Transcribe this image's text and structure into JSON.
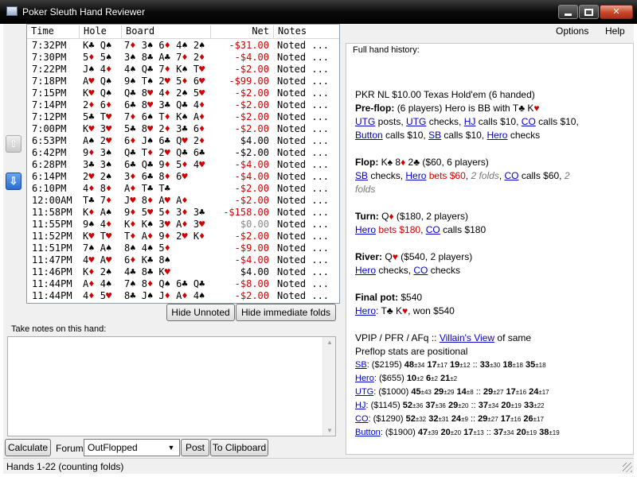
{
  "window": {
    "title": "Poker Sleuth Hand Reviewer",
    "minimize": "",
    "maximize": "",
    "close": "✕"
  },
  "menu": {
    "options": "Options",
    "help": "Help"
  },
  "nav": {
    "up_arrow": "up-arrow-icon",
    "down_arrow": "down-arrow-icon"
  },
  "hands": {
    "columns": [
      "Time",
      "Hole",
      "Board",
      "Net",
      "Notes"
    ],
    "rows": [
      {
        "time": "7:32PM",
        "hole": [
          [
            "K",
            "♣"
          ],
          [
            "Q",
            "♠"
          ]
        ],
        "board": [
          [
            "7",
            "♦"
          ],
          [
            "3",
            "♠"
          ],
          [
            "6",
            "♦"
          ],
          [
            "4",
            "♠"
          ],
          [
            "2",
            "♠"
          ]
        ],
        "net": "-$31.00",
        "net_color": "red",
        "notes": "Noted ..."
      },
      {
        "time": "7:30PM",
        "hole": [
          [
            "5",
            "♦"
          ],
          [
            "5",
            "♠"
          ]
        ],
        "board": [
          [
            "3",
            "♠"
          ],
          [
            "8",
            "♣"
          ],
          [
            "A",
            "♣"
          ],
          [
            "7",
            "♦"
          ],
          [
            "2",
            "♦"
          ]
        ],
        "net": "-$4.00",
        "net_color": "red",
        "notes": "Noted ..."
      },
      {
        "time": "7:22PM",
        "hole": [
          [
            "J",
            "♠"
          ],
          [
            "4",
            "♦"
          ]
        ],
        "board": [
          [
            "4",
            "♠"
          ],
          [
            "Q",
            "♣"
          ],
          [
            "7",
            "♦"
          ],
          [
            "K",
            "♠"
          ],
          [
            "T",
            "♥"
          ]
        ],
        "net": "-$2.00",
        "net_color": "red",
        "notes": "Noted ..."
      },
      {
        "time": "7:18PM",
        "hole": [
          [
            "A",
            "♥"
          ],
          [
            "Q",
            "♠"
          ]
        ],
        "board": [
          [
            "9",
            "♠"
          ],
          [
            "T",
            "♠"
          ],
          [
            "2",
            "♥"
          ],
          [
            "5",
            "♦"
          ],
          [
            "6",
            "♥"
          ]
        ],
        "net": "-$99.00",
        "net_color": "red",
        "notes": "Noted ..."
      },
      {
        "time": "7:15PM",
        "hole": [
          [
            "K",
            "♥"
          ],
          [
            "Q",
            "♠"
          ]
        ],
        "board": [
          [
            "Q",
            "♣"
          ],
          [
            "8",
            "♥"
          ],
          [
            "4",
            "♦"
          ],
          [
            "2",
            "♠"
          ],
          [
            "5",
            "♥"
          ]
        ],
        "net": "-$2.00",
        "net_color": "red",
        "notes": "Noted ..."
      },
      {
        "time": "7:14PM",
        "hole": [
          [
            "2",
            "♦"
          ],
          [
            "6",
            "♦"
          ]
        ],
        "board": [
          [
            "6",
            "♣"
          ],
          [
            "8",
            "♥"
          ],
          [
            "3",
            "♣"
          ],
          [
            "Q",
            "♣"
          ],
          [
            "4",
            "♦"
          ]
        ],
        "net": "-$2.00",
        "net_color": "red",
        "notes": "Noted ..."
      },
      {
        "time": "7:12PM",
        "hole": [
          [
            "5",
            "♣"
          ],
          [
            "T",
            "♥"
          ]
        ],
        "board": [
          [
            "7",
            "♦"
          ],
          [
            "6",
            "♠"
          ],
          [
            "T",
            "♦"
          ],
          [
            "K",
            "♠"
          ],
          [
            "A",
            "♦"
          ]
        ],
        "net": "-$2.00",
        "net_color": "red",
        "notes": "Noted ..."
      },
      {
        "time": "7:00PM",
        "hole": [
          [
            "K",
            "♥"
          ],
          [
            "3",
            "♥"
          ]
        ],
        "board": [
          [
            "5",
            "♣"
          ],
          [
            "8",
            "♥"
          ],
          [
            "2",
            "♦"
          ],
          [
            "3",
            "♣"
          ],
          [
            "6",
            "♦"
          ]
        ],
        "net": "-$2.00",
        "net_color": "red",
        "notes": "Noted ..."
      },
      {
        "time": "6:53PM",
        "hole": [
          [
            "A",
            "♠"
          ],
          [
            "2",
            "♥"
          ]
        ],
        "board": [
          [
            "6",
            "♦"
          ],
          [
            "J",
            "♠"
          ],
          [
            "6",
            "♣"
          ],
          [
            "Q",
            "♥"
          ],
          [
            "2",
            "♦"
          ]
        ],
        "net": "$4.00",
        "net_color": "black",
        "notes": "Noted ..."
      },
      {
        "time": "6:42PM",
        "hole": [
          [
            "9",
            "♦"
          ],
          [
            "3",
            "♠"
          ]
        ],
        "board": [
          [
            "Q",
            "♣"
          ],
          [
            "T",
            "♦"
          ],
          [
            "2",
            "♥"
          ],
          [
            "Q",
            "♣"
          ],
          [
            "6",
            "♣"
          ]
        ],
        "net": "-$2.00",
        "net_color": "black",
        "notes": "Noted ..."
      },
      {
        "time": "6:28PM",
        "hole": [
          [
            "3",
            "♣"
          ],
          [
            "3",
            "♠"
          ]
        ],
        "board": [
          [
            "6",
            "♣"
          ],
          [
            "Q",
            "♣"
          ],
          [
            "9",
            "♦"
          ],
          [
            "5",
            "♦"
          ],
          [
            "4",
            "♥"
          ]
        ],
        "net": "-$4.00",
        "net_color": "red",
        "notes": "Noted ..."
      },
      {
        "time": "6:14PM",
        "hole": [
          [
            "2",
            "♥"
          ],
          [
            "2",
            "♠"
          ]
        ],
        "board": [
          [
            "3",
            "♦"
          ],
          [
            "6",
            "♣"
          ],
          [
            "8",
            "♦"
          ],
          [
            "6",
            "♥"
          ]
        ],
        "net": "-$4.00",
        "net_color": "red",
        "notes": "Noted ..."
      },
      {
        "time": "6:10PM",
        "hole": [
          [
            "4",
            "♦"
          ],
          [
            "8",
            "♦"
          ]
        ],
        "board": [
          [
            "A",
            "♦"
          ],
          [
            "T",
            "♣"
          ],
          [
            "T",
            "♣"
          ]
        ],
        "net": "-$2.00",
        "net_color": "red",
        "notes": "Noted ..."
      },
      {
        "time": "12:00AM",
        "hole": [
          [
            "T",
            "♣"
          ],
          [
            "7",
            "♦"
          ]
        ],
        "board": [
          [
            "J",
            "♥"
          ],
          [
            "8",
            "♦"
          ],
          [
            "A",
            "♥"
          ],
          [
            "A",
            "♦"
          ]
        ],
        "net": "-$2.00",
        "net_color": "red",
        "notes": "Noted ..."
      },
      {
        "time": "11:58PM",
        "hole": [
          [
            "K",
            "♦"
          ],
          [
            "A",
            "♠"
          ]
        ],
        "board": [
          [
            "9",
            "♦"
          ],
          [
            "5",
            "♥"
          ],
          [
            "5",
            "♦"
          ],
          [
            "3",
            "♦"
          ],
          [
            "3",
            "♣"
          ]
        ],
        "net": "-$158.00",
        "net_color": "red",
        "notes": "Noted ..."
      },
      {
        "time": "11:55PM",
        "hole": [
          [
            "9",
            "♠"
          ],
          [
            "4",
            "♦"
          ]
        ],
        "board": [
          [
            "K",
            "♦"
          ],
          [
            "K",
            "♠"
          ],
          [
            "3",
            "♥"
          ],
          [
            "A",
            "♦"
          ],
          [
            "3",
            "♥"
          ]
        ],
        "net": "$0.00",
        "net_color": "grey",
        "notes": "Noted ..."
      },
      {
        "time": "11:52PM",
        "hole": [
          [
            "K",
            "♥"
          ],
          [
            "T",
            "♥"
          ]
        ],
        "board": [
          [
            "T",
            "♦"
          ],
          [
            "A",
            "♦"
          ],
          [
            "9",
            "♦"
          ],
          [
            "2",
            "♥"
          ],
          [
            "K",
            "♦"
          ]
        ],
        "net": "-$2.00",
        "net_color": "red",
        "notes": "Noted ..."
      },
      {
        "time": "11:51PM",
        "hole": [
          [
            "7",
            "♠"
          ],
          [
            "A",
            "♠"
          ]
        ],
        "board": [
          [
            "8",
            "♠"
          ],
          [
            "4",
            "♠"
          ],
          [
            "5",
            "♦"
          ]
        ],
        "net": "-$9.00",
        "net_color": "red",
        "notes": "Noted ..."
      },
      {
        "time": "11:47PM",
        "hole": [
          [
            "4",
            "♥"
          ],
          [
            "A",
            "♥"
          ]
        ],
        "board": [
          [
            "6",
            "♦"
          ],
          [
            "K",
            "♣"
          ],
          [
            "8",
            "♠"
          ]
        ],
        "net": "-$4.00",
        "net_color": "red",
        "notes": "Noted ..."
      },
      {
        "time": "11:46PM",
        "hole": [
          [
            "K",
            "♦"
          ],
          [
            "2",
            "♠"
          ]
        ],
        "board": [
          [
            "4",
            "♣"
          ],
          [
            "8",
            "♣"
          ],
          [
            "K",
            "♥"
          ]
        ],
        "net": "$4.00",
        "net_color": "black",
        "notes": "Noted ..."
      },
      {
        "time": "11:44PM",
        "hole": [
          [
            "A",
            "♦"
          ],
          [
            "4",
            "♠"
          ]
        ],
        "board": [
          [
            "7",
            "♠"
          ],
          [
            "8",
            "♦"
          ],
          [
            "Q",
            "♠"
          ],
          [
            "6",
            "♣"
          ],
          [
            "Q",
            "♣"
          ]
        ],
        "net": "-$8.00",
        "net_color": "red",
        "notes": "Noted ..."
      },
      {
        "time": "11:44PM",
        "hole": [
          [
            "4",
            "♦"
          ],
          [
            "5",
            "♥"
          ]
        ],
        "board": [
          [
            "8",
            "♣"
          ],
          [
            "J",
            "♠"
          ],
          [
            "J",
            "♦"
          ],
          [
            "A",
            "♦"
          ],
          [
            "4",
            "♠"
          ]
        ],
        "net": "-$2.00",
        "net_color": "red",
        "notes": "Noted ..."
      }
    ]
  },
  "buttons": {
    "hide_unnoted": "Hide Unnoted",
    "hide_immediate": "Hide immediate folds",
    "calculate": "Calculate",
    "post": "Post",
    "clipboard": "To Clipboard"
  },
  "notes": {
    "label": "Take notes on this hand:",
    "value": ""
  },
  "forum": {
    "label": "Forum:",
    "selected": "OutFlopped"
  },
  "status": {
    "text": "Hands 1-22 (counting folds)"
  },
  "history": {
    "title": "Full hand history:",
    "game_line": "PKR NL $10.00 Texas Hold'em (6 handed)",
    "preflop_label": "Pre-flop:",
    "preflop_desc": "(6 players) Hero is BB with T",
    "hero_hole_2": "K",
    "flop_label": "Flop:",
    "flop_cards": "K♠ 8♦ 2♣",
    "flop_pot": "($60, 6 players)",
    "turn_label": "Turn:",
    "turn_card": "Q♦",
    "turn_pot": "($180, 2 players)",
    "river_label": "River:",
    "river_card": "Q♥",
    "river_pot": "($540, 2 players)",
    "final_label": "Final pot:",
    "final_value": "$540",
    "hero_won": "Hero",
    "won_text": ", won $540",
    "hero_cards": ": T♣ K♥",
    "vpip_line": "VPIP / PFR / AFq ::",
    "villains_view": "Villain's View",
    "of_same": "of same",
    "positional": "Preflop stats are positional"
  }
}
